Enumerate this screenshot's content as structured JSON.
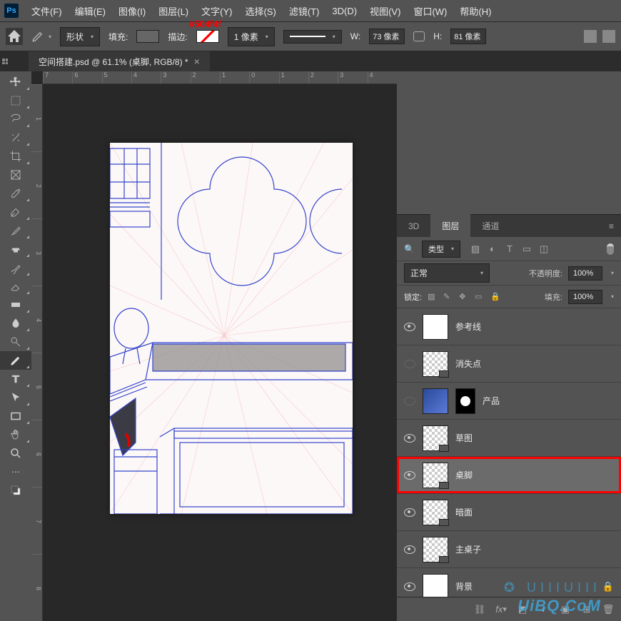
{
  "menubar": {
    "items": [
      "文件(F)",
      "编辑(E)",
      "图像(I)",
      "图层(L)",
      "文字(Y)",
      "选择(S)",
      "滤镜(T)",
      "3D(D)",
      "视图(V)",
      "窗口(W)",
      "帮助(H)"
    ]
  },
  "color_annotation": "#504f4f",
  "optbar": {
    "shape_mode": "形状",
    "fill_label": "填充:",
    "stroke_label": "描边:",
    "stroke_width": "1 像素",
    "w_label": "W:",
    "w_value": "73 像素",
    "h_label": "H:",
    "h_value": "81 像素"
  },
  "tab": {
    "title": "空间搭建.psd @ 61.1% (桌脚, RGB/8) *",
    "close": "×"
  },
  "ruler_h": [
    "7",
    "6",
    "5",
    "4",
    "3",
    "2",
    "1",
    "0",
    "1",
    "2",
    "3",
    "4"
  ],
  "ruler_v": [
    "1",
    "2",
    "3",
    "4",
    "5",
    "6",
    "7",
    "8"
  ],
  "panels": {
    "tabs": [
      "3D",
      "图层",
      "通道"
    ],
    "filter_label": "类型",
    "blend_mode": "正常",
    "opacity_label": "不透明度:",
    "opacity_value": "100%",
    "lock_label": "锁定:",
    "fill_label": "填充:",
    "fill_value": "100%"
  },
  "layers": [
    {
      "name": "参考线",
      "visible": true,
      "thumb": "plain"
    },
    {
      "name": "消失点",
      "visible": false,
      "thumb": "checker",
      "shape": true
    },
    {
      "name": "产品",
      "visible": false,
      "thumb": "blue",
      "mask": true
    },
    {
      "name": "草图",
      "visible": true,
      "thumb": "checker",
      "shape": true
    },
    {
      "name": "桌脚",
      "visible": true,
      "thumb": "checker",
      "shape": true,
      "selected": true,
      "highlighted": true
    },
    {
      "name": "暗面",
      "visible": true,
      "thumb": "checker",
      "shape": true
    },
    {
      "name": "主桌子",
      "visible": true,
      "thumb": "checker",
      "shape": true
    },
    {
      "name": "背景",
      "visible": true,
      "thumb": "plain",
      "locked": true
    }
  ],
  "watermark": "UiBQ.CoM",
  "watermark_icon": "✪ UIIIUIII"
}
